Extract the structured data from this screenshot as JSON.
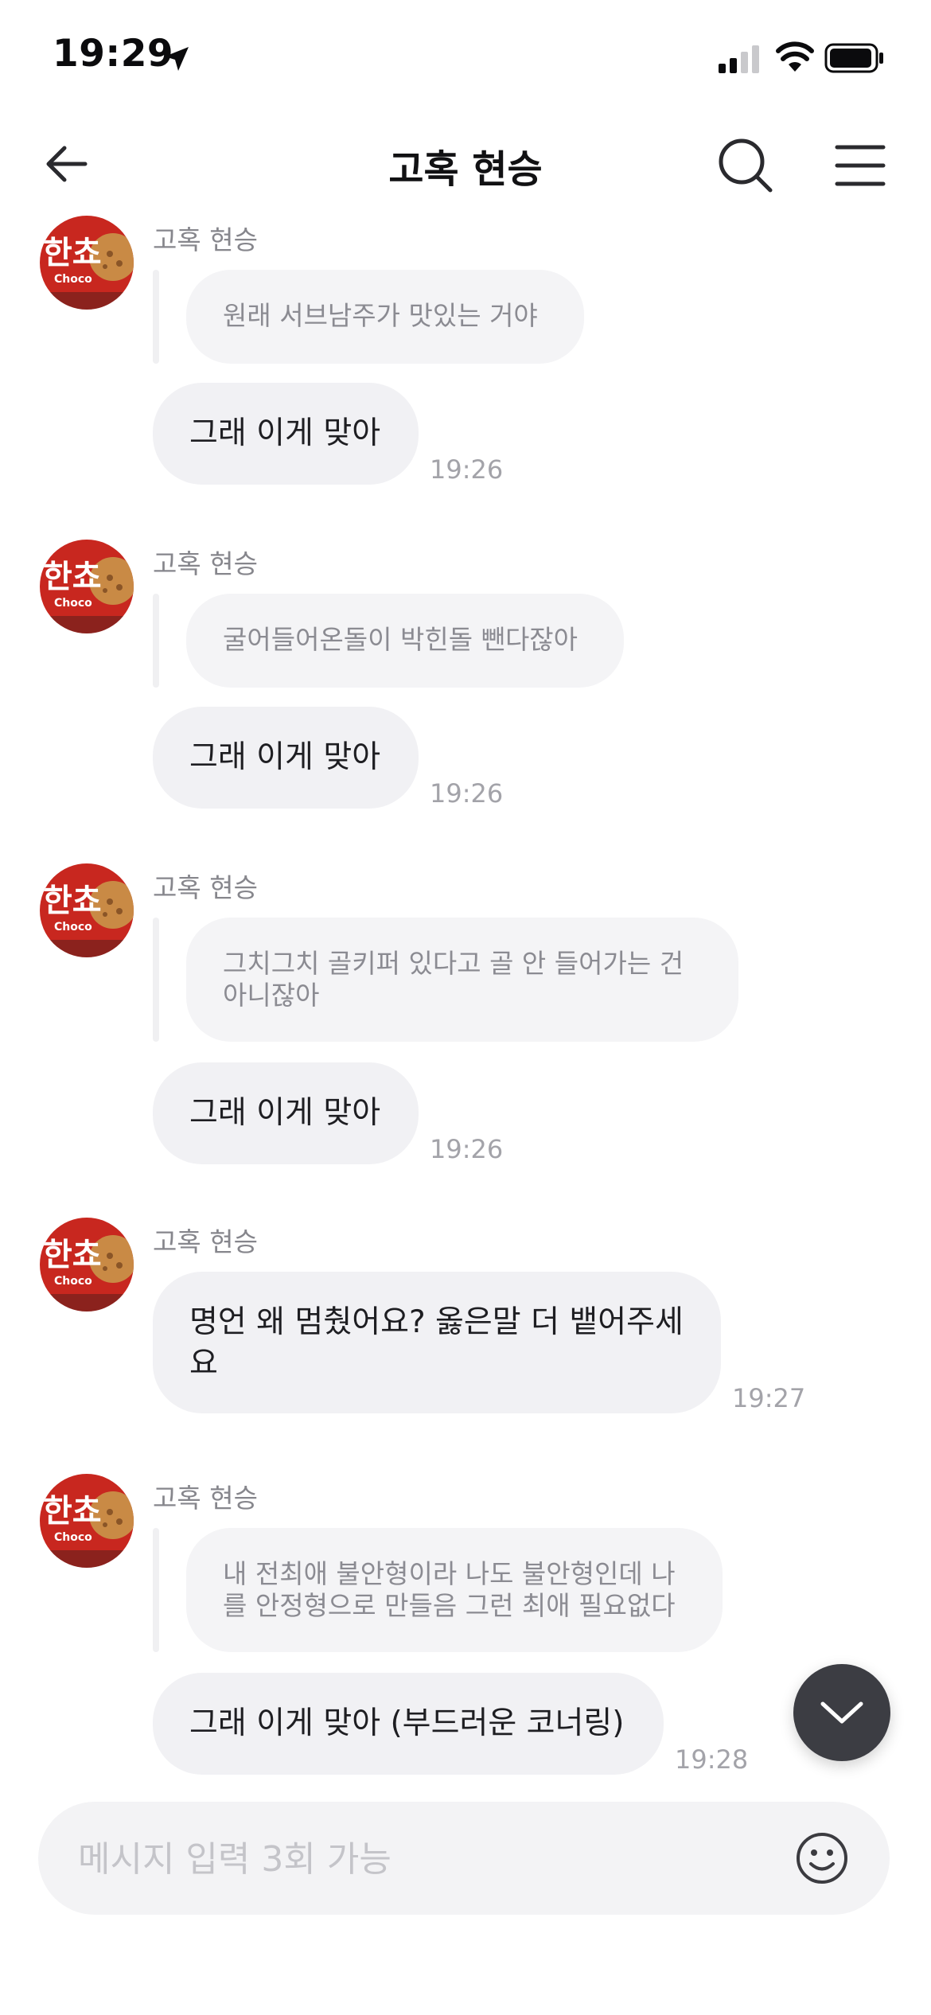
{
  "status_bar": {
    "time": "19:29",
    "icons": [
      "location-arrow-icon",
      "cellular-signal-icon",
      "wifi-icon",
      "battery-icon"
    ]
  },
  "header": {
    "title": "고혹 현승",
    "icons": [
      "back-arrow-icon",
      "search-icon",
      "menu-icon"
    ]
  },
  "messages": [
    {
      "sender": "고혹 현승",
      "reply_to": "원래 서브남주가 맛있는 거야",
      "text": "그래 이게 맞아",
      "time": "19:26"
    },
    {
      "sender": "고혹 현승",
      "reply_to": "굴어들어온돌이 박힌돌 뺀다잖아",
      "text": "그래 이게 맞아",
      "time": "19:26"
    },
    {
      "sender": "고혹 현승",
      "reply_to": "그치그치 골키퍼 있다고 골 안 들어가는 건 아니잖아",
      "text": "그래 이게 맞아",
      "time": "19:26"
    },
    {
      "sender": "고혹 현승",
      "reply_to": "",
      "text": "명언 왜 멈췄어요? 옳은말 더 뱉어주세요",
      "time": "19:27"
    },
    {
      "sender": "고혹 현승",
      "reply_to": "내 전최애 불안형이라 나도 불안형인데 나를 안정형으로 만들음 그런 최애 필요없다",
      "text": "그래 이게 맞아 (부드러운 코너링)",
      "time": "19:28"
    }
  ],
  "avatar": {
    "text": "한쵸",
    "subtext": "Choco",
    "colors": {
      "bg": "#c8271f",
      "cookie": "#c98a45",
      "text": "#ffffff"
    }
  },
  "input": {
    "placeholder": "메시지 입력 3회 가능",
    "value": ""
  },
  "colors": {
    "bubble": "#f1f1f4",
    "reply_bubble": "#f4f4f6",
    "timestamp": "#a3a3a9",
    "fab": "#3c3d43"
  }
}
